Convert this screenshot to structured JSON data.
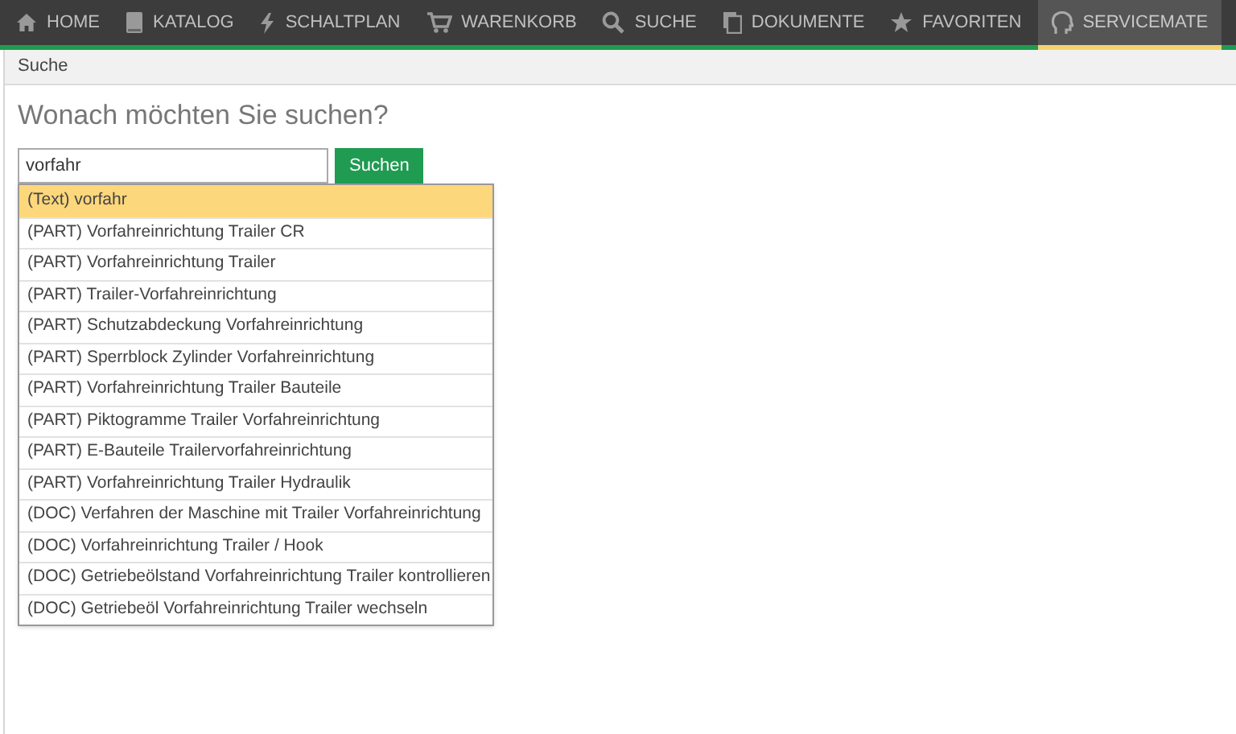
{
  "nav": [
    {
      "label": "HOME",
      "kind": "home",
      "selected": false
    },
    {
      "label": "KATALOG",
      "kind": "book",
      "selected": false
    },
    {
      "label": "SCHALTPLAN",
      "kind": "bolt",
      "selected": false
    },
    {
      "label": "WARENKORB",
      "kind": "cart",
      "selected": false
    },
    {
      "label": "SUCHE",
      "kind": "search",
      "selected": false
    },
    {
      "label": "DOKUMENTE",
      "kind": "docs",
      "selected": false
    },
    {
      "label": "FAVORITEN",
      "kind": "star",
      "selected": false
    },
    {
      "label": "SERVICEMATE",
      "kind": "head",
      "selected": true
    }
  ],
  "breadcrumb": "Suche",
  "heading": "Wonach möchten Sie suchen?",
  "search": {
    "value": "vorfahr",
    "button": "Suchen"
  },
  "suggestions": [
    {
      "label": "(Text) vorfahr",
      "selected": true
    },
    {
      "label": "(PART) Vorfahreinrichtung Trailer CR",
      "selected": false
    },
    {
      "label": "(PART) Vorfahreinrichtung Trailer",
      "selected": false
    },
    {
      "label": "(PART) Trailer-Vorfahreinrichtung",
      "selected": false
    },
    {
      "label": "(PART) Schutzabdeckung Vorfahreinrichtung",
      "selected": false
    },
    {
      "label": "(PART) Sperrblock Zylinder Vorfahreinrichtung",
      "selected": false
    },
    {
      "label": "(PART) Vorfahreinrichtung Trailer Bauteile",
      "selected": false
    },
    {
      "label": "(PART) Piktogramme Trailer Vorfahreinrichtung",
      "selected": false
    },
    {
      "label": "(PART) E-Bauteile Trailervorfahreinrichtung",
      "selected": false
    },
    {
      "label": "(PART) Vorfahreinrichtung Trailer Hydraulik",
      "selected": false
    },
    {
      "label": "(DOC) Verfahren der Maschine mit Trailer Vorfahreinrichtung",
      "selected": false
    },
    {
      "label": "(DOC) Vorfahreinrichtung Trailer / Hook",
      "selected": false
    },
    {
      "label": "(DOC) Getriebeölstand Vorfahreinrichtung Trailer kontrollieren",
      "selected": false
    },
    {
      "label": "(DOC) Getriebeöl Vorfahreinrichtung Trailer wechseln",
      "selected": false
    }
  ]
}
